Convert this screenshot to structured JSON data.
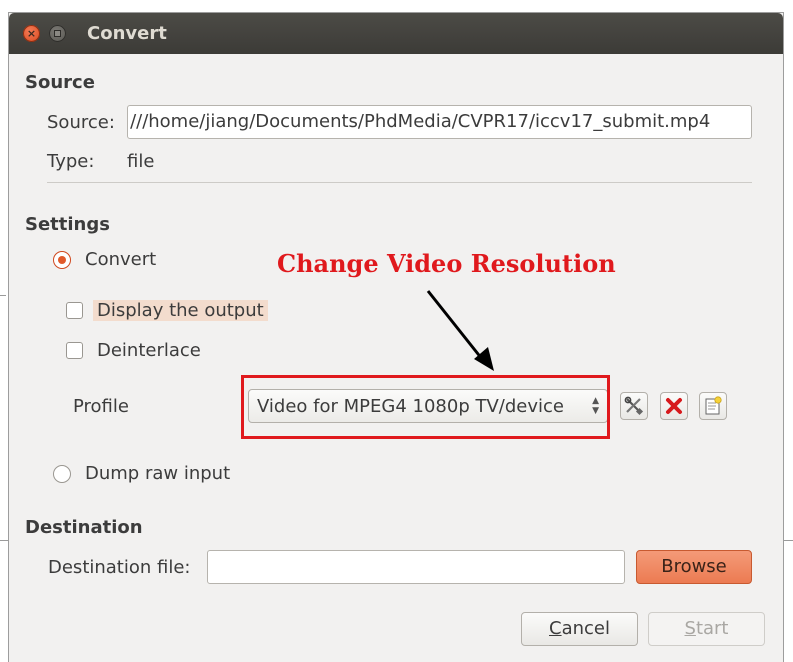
{
  "window": {
    "title": "Convert"
  },
  "source": {
    "section_title": "Source",
    "source_label": "Source:",
    "source_value": ":///home/jiang/Documents/PhdMedia/CVPR17/iccv17_submit.mp4",
    "type_label": "Type:",
    "type_value": "file"
  },
  "settings": {
    "section_title": "Settings",
    "convert_label": "Convert",
    "convert_selected": true,
    "display_output_label": "Display the output",
    "display_output_checked": false,
    "deinterlace_label": "Deinterlace",
    "deinterlace_checked": false,
    "profile_label": "Profile",
    "profile_value": "Video for MPEG4 1080p TV/device",
    "dump_raw_label": "Dump raw input",
    "dump_raw_selected": false
  },
  "destination": {
    "section_title": "Destination",
    "file_label": "Destination file:",
    "file_value": "",
    "browse_label": "Browse"
  },
  "buttons": {
    "cancel_label": "Cancel",
    "cancel_mnemonic": "C",
    "cancel_rest": "ancel",
    "start_label": "Start",
    "start_mnemonic": "S",
    "start_rest": "tart"
  },
  "annotation": {
    "text": "Change Video Resolution",
    "color": "#e0191d"
  },
  "colors": {
    "accent": "#e15a2b",
    "titlebar": "#3c3b37",
    "dialog_bg": "#f2f1f0"
  }
}
